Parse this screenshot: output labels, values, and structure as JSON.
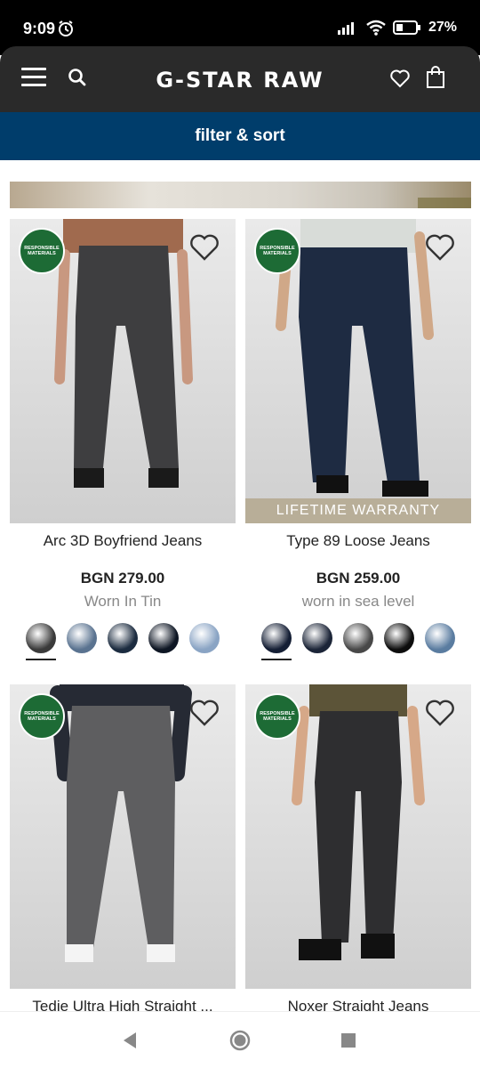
{
  "status": {
    "time": "9:09",
    "battery": "27%"
  },
  "header": {
    "brand": "G-STAR RAW"
  },
  "filter": {
    "label": "filter & sort"
  },
  "products": [
    {
      "title": "Arc 3D Boyfriend Jeans",
      "price": "BGN 279.00",
      "color_name": "Worn In Tin",
      "badge": "RESPONSIBLE MATERIALS",
      "jean_color": "#3e3e40",
      "top_color": "#a06a4e",
      "swatches": [
        "#3a3a3a",
        "#5a7390",
        "#1c2c40",
        "#0e1624",
        "#8aa4c4"
      ]
    },
    {
      "title": "Type 89 Loose Jeans",
      "price": "BGN 259.00",
      "color_name": "worn in sea level",
      "badge": "RESPONSIBLE MATERIALS",
      "warranty": "LIFETIME WARRANTY",
      "jean_color": "#1e2b42",
      "top_color": "#d8dcd8",
      "swatches": [
        "#141e34",
        "#1c2538",
        "#484848",
        "#0d0d0d",
        "#5a7ca0"
      ]
    },
    {
      "title": "Tedie Ultra High Straight ...",
      "badge": "RESPONSIBLE MATERIALS",
      "jean_color": "#5e5e60",
      "top_color": "#262a34"
    },
    {
      "title": "Noxer Straight Jeans",
      "badge": "RESPONSIBLE MATERIALS",
      "jean_color": "#2e2e30",
      "top_color": "#5c5438"
    }
  ]
}
